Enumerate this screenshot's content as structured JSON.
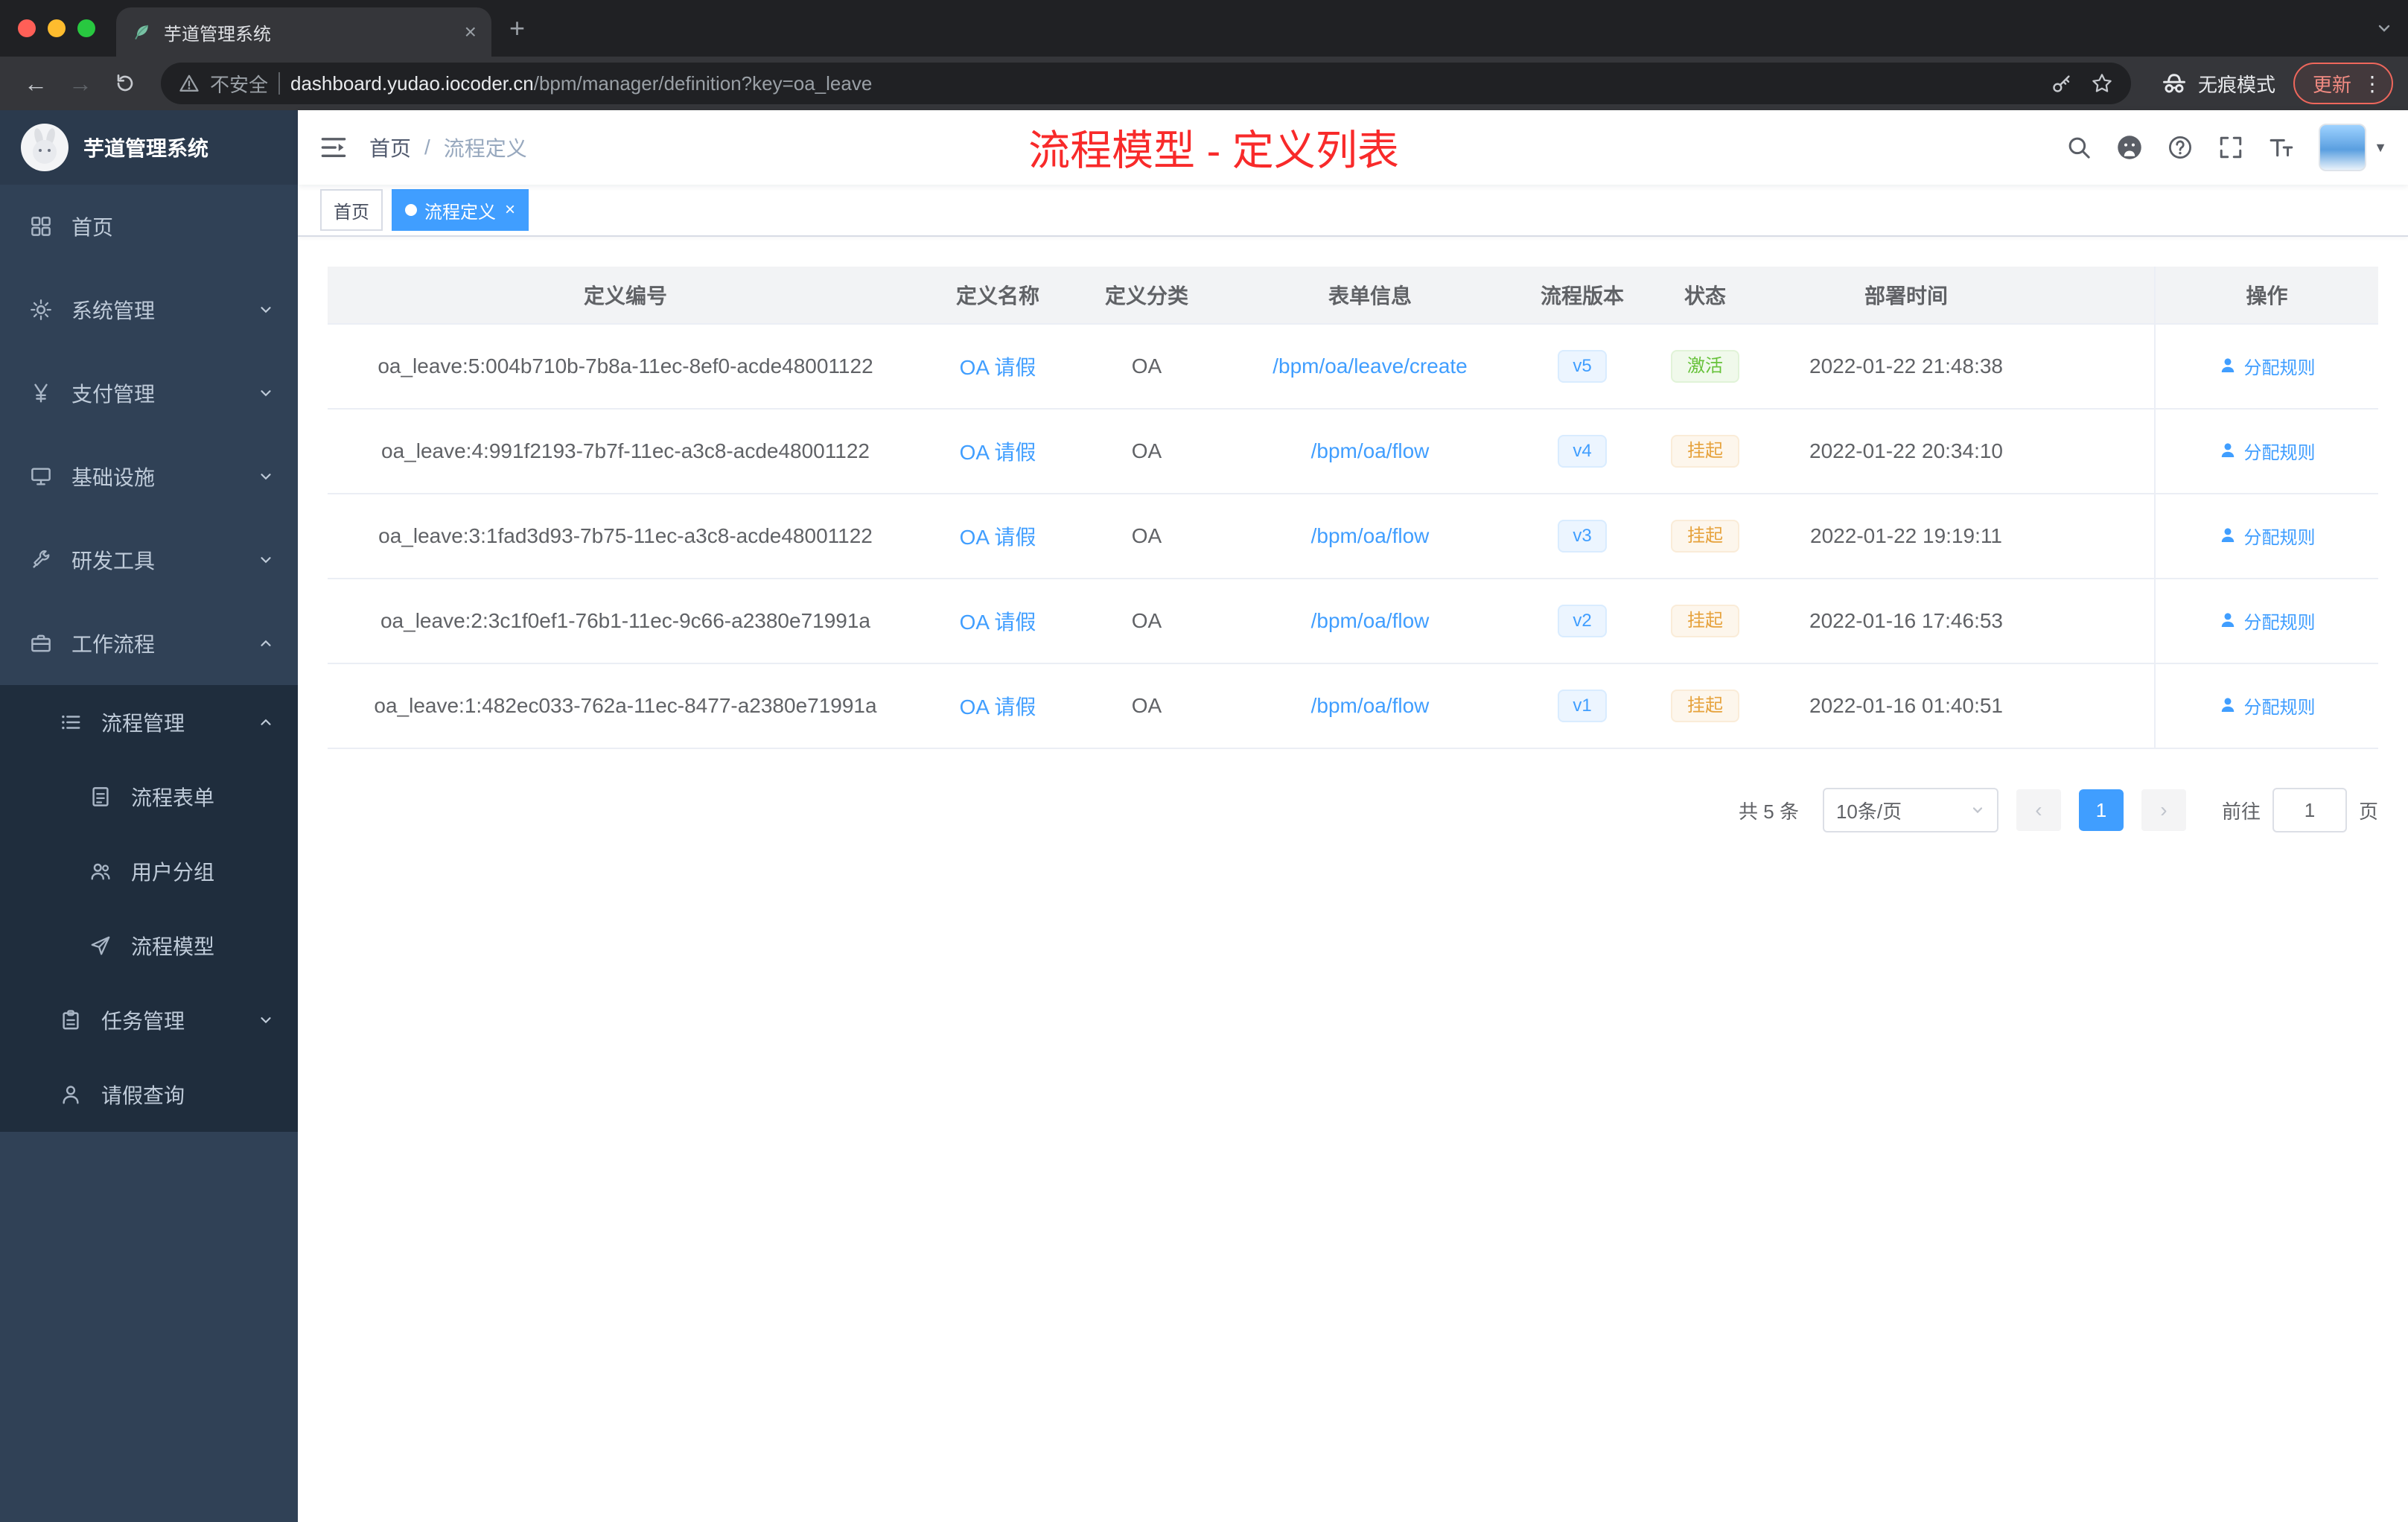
{
  "icons": {
    "close": "×",
    "plus": "+",
    "kebab": "⋮",
    "caret_down": "▼",
    "arrow_back": "←",
    "arrow_forward": "→",
    "prev": "‹",
    "next": "›"
  },
  "colors": {
    "accent": "#409eff",
    "annotation_red": "#f82a2a",
    "status_active_green": "#67c23a",
    "status_suspend_orange": "#e6a23c",
    "sidebar_bg": "#304156",
    "submenu_bg": "#1f2d3d"
  },
  "browser": {
    "tab": {
      "title": "芋道管理系统"
    },
    "toolbar": {
      "security_label": "不安全",
      "url_host": "dashboard.yudao.iocoder.cn",
      "url_path": "/bpm/manager/definition?key=oa_leave",
      "incognito_label": "无痕模式",
      "update_label": "更新"
    }
  },
  "sidebar": {
    "brand": "芋道管理系统",
    "items": [
      {
        "label": "首页"
      },
      {
        "label": "系统管理"
      },
      {
        "label": "支付管理"
      },
      {
        "label": "基础设施"
      },
      {
        "label": "研发工具"
      },
      {
        "label": "工作流程"
      },
      {
        "label": "流程管理"
      },
      {
        "label": "流程表单"
      },
      {
        "label": "用户分组"
      },
      {
        "label": "流程模型"
      },
      {
        "label": "任务管理"
      },
      {
        "label": "请假查询"
      }
    ]
  },
  "navbar": {
    "breadcrumb": {
      "home": "首页",
      "separator": "/",
      "current": "流程定义"
    },
    "annotation": "流程模型 - 定义列表"
  },
  "tags": {
    "home": "首页",
    "active": "流程定义"
  },
  "table": {
    "columns": {
      "id": "定义编号",
      "name": "定义名称",
      "category": "定义分类",
      "form": "表单信息",
      "version": "流程版本",
      "status": "状态",
      "deploy_time": "部署时间",
      "actions": "操作"
    },
    "rows": [
      {
        "id": "oa_leave:5:004b710b-7b8a-11ec-8ef0-acde48001122",
        "name": "OA 请假",
        "category": "OA",
        "form": "/bpm/oa/leave/create",
        "version": "v5",
        "status": "激活",
        "status_type": "success",
        "deploy_time": "2022-01-22 21:48:38",
        "action": "分配规则"
      },
      {
        "id": "oa_leave:4:991f2193-7b7f-11ec-a3c8-acde48001122",
        "name": "OA 请假",
        "category": "OA",
        "form": "/bpm/oa/flow",
        "version": "v4",
        "status": "挂起",
        "status_type": "warning",
        "deploy_time": "2022-01-22 20:34:10",
        "action": "分配规则"
      },
      {
        "id": "oa_leave:3:1fad3d93-7b75-11ec-a3c8-acde48001122",
        "name": "OA 请假",
        "category": "OA",
        "form": "/bpm/oa/flow",
        "version": "v3",
        "status": "挂起",
        "status_type": "warning",
        "deploy_time": "2022-01-22 19:19:11",
        "action": "分配规则"
      },
      {
        "id": "oa_leave:2:3c1f0ef1-76b1-11ec-9c66-a2380e71991a",
        "name": "OA 请假",
        "category": "OA",
        "form": "/bpm/oa/flow",
        "version": "v2",
        "status": "挂起",
        "status_type": "warning",
        "deploy_time": "2022-01-16 17:46:53",
        "action": "分配规则"
      },
      {
        "id": "oa_leave:1:482ec033-762a-11ec-8477-a2380e71991a",
        "name": "OA 请假",
        "category": "OA",
        "form": "/bpm/oa/flow",
        "version": "v1",
        "status": "挂起",
        "status_type": "warning",
        "deploy_time": "2022-01-16 01:40:51",
        "action": "分配规则"
      }
    ]
  },
  "pagination": {
    "total": "共 5 条",
    "page_size": "10条/页",
    "current_page": "1",
    "goto_label": "前往",
    "goto_value": "1",
    "page_unit": "页"
  }
}
